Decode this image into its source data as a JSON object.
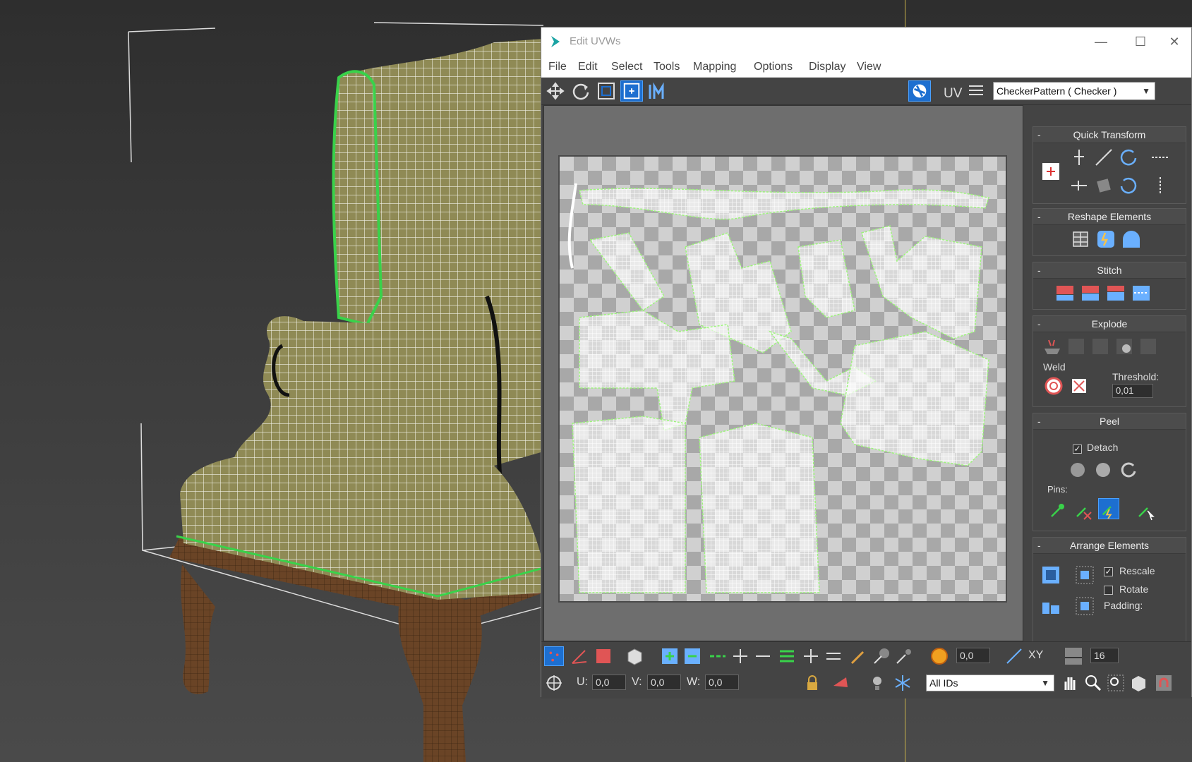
{
  "window": {
    "title": "Edit UVWs",
    "minimize": "—",
    "maximize": "☐",
    "close": "✕"
  },
  "menu": [
    "File",
    "Edit",
    "Select",
    "Tools",
    "Mapping",
    "Options",
    "Display",
    "View"
  ],
  "toolbar": {
    "uv_label": "UV",
    "texture_select": "CheckerPattern  ( Checker )"
  },
  "rollouts": {
    "quick_transform": "Quick Transform",
    "reshape_elements": "Reshape Elements",
    "stitch": "Stitch",
    "explode": "Explode",
    "weld_label": "Weld",
    "threshold_label": "Threshold:",
    "threshold_value": "0,01",
    "peel": "Peel",
    "detach_label": "Detach",
    "pins_label": "Pins:",
    "arrange_elements": "Arrange Elements",
    "rescale_label": "Rescale",
    "rotate_label": "Rotate",
    "padding_label": "Padding:"
  },
  "bottombar": {
    "soft_value": "0,0",
    "xy_label": "XY",
    "grid_value": "16",
    "u_label": "U:",
    "u_value": "0,0",
    "v_label": "V:",
    "v_value": "0,0",
    "w_label": "W:",
    "w_value": "0,0",
    "ids_select": "All IDs"
  },
  "colors": {
    "accent": "#1d6fd0",
    "seam_green": "#39d24a",
    "fabric": "#8f8a55",
    "wood": "#6a4426"
  }
}
